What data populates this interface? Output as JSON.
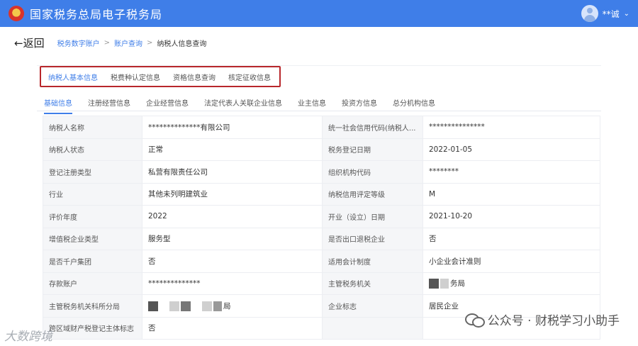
{
  "header": {
    "title": "国家税务总局电子税务局",
    "user_name": "**诚",
    "chevron": "⌄"
  },
  "breadcrumb": {
    "back_label": "←返回",
    "items": [
      "税务数字账户",
      "账户查询",
      "纳税人信息查询"
    ],
    "separator": ">"
  },
  "main_tabs": [
    "纳税人基本信息",
    "税费种认定信息",
    "资格信息查询",
    "核定征收信息"
  ],
  "sub_tabs": [
    "基础信息",
    "注册经营信息",
    "企业经营信息",
    "法定代表人关联企业信息",
    "业主信息",
    "投资方信息",
    "总分机构信息"
  ],
  "rows": [
    {
      "l1": "纳税人名称",
      "v1": "**************有限公司",
      "l2": "统一社会信用代码(纳税人...",
      "v2": "***************"
    },
    {
      "l1": "纳税人状态",
      "v1": "正常",
      "l2": "税务登记日期",
      "v2": "2022-01-05"
    },
    {
      "l1": "登记注册类型",
      "v1": "私营有限责任公司",
      "l2": "组织机构代码",
      "v2": "********"
    },
    {
      "l1": "行业",
      "v1": "其他未列明建筑业",
      "l2": "纳税信用评定等级",
      "v2": "M"
    },
    {
      "l1": "评价年度",
      "v1": "2022",
      "l2": "开业（设立）日期",
      "v2": "2021-10-20"
    },
    {
      "l1": "增值税企业类型",
      "v1": "服务型",
      "l2": "是否出口退税企业",
      "v2": "否"
    },
    {
      "l1": "是否千户集团",
      "v1": "否",
      "l2": "适用会计制度",
      "v2": "小企业会计准则"
    },
    {
      "l1": "存款账户",
      "v1": "**************",
      "l2": "主管税务机关",
      "v2": "务局"
    },
    {
      "l1": "主管税务机关科所分局",
      "v1": "局",
      "l2": "企业标志",
      "v2": "居民企业"
    },
    {
      "l1": "跨区域财产税登记主体标志",
      "v1": "否",
      "l2": "",
      "v2": ""
    }
  ],
  "watermark": {
    "text": "公众号 · 财税学习小助手",
    "corner_text": "大数跨境"
  },
  "colors": {
    "header_bg": "#3f7ee8",
    "accent": "#3f7ee8",
    "highlight_border": "#b8272b"
  }
}
